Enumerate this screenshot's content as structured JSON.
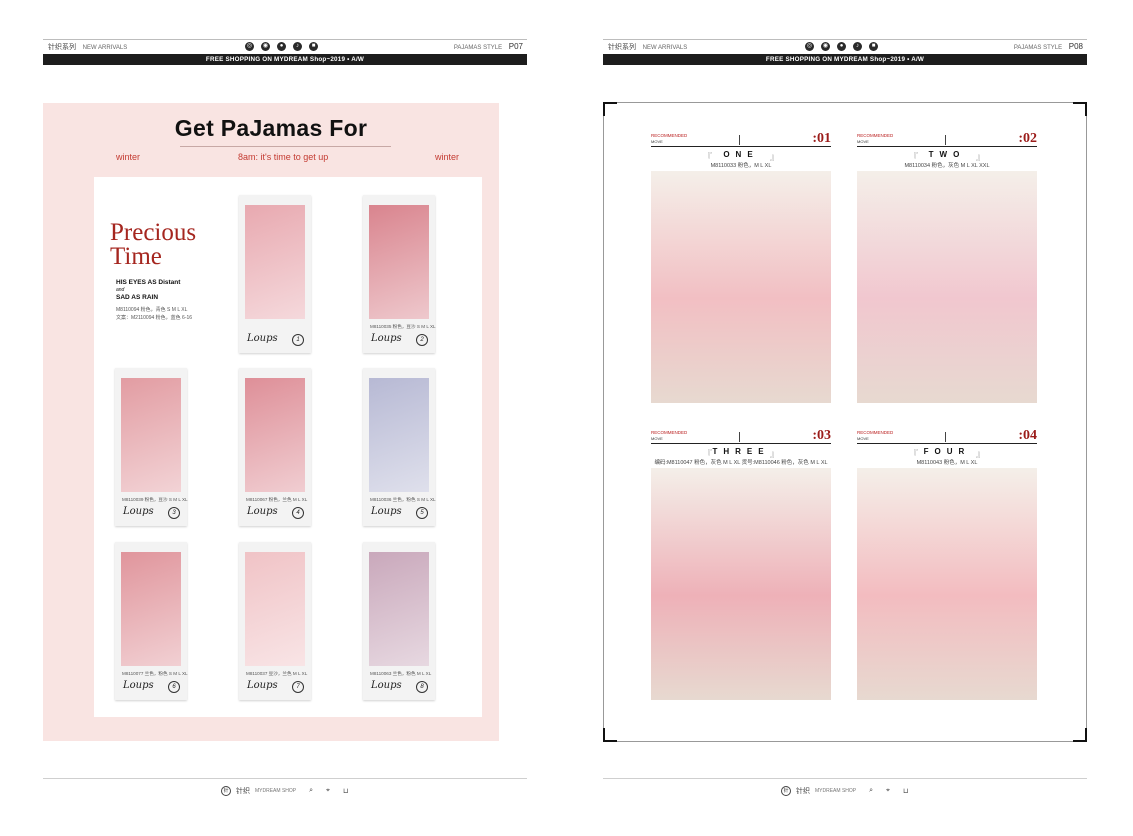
{
  "header": {
    "brand": "针织系列",
    "tagline": "NEW ARRIVALS",
    "right_label": "PAJAMAS STYLE",
    "left_page": "P07",
    "right_page": "P08",
    "banner": "FREE SHOPPING ON MYDREAM Shop~2019 • A/W"
  },
  "footer": {
    "brand": "针织",
    "site": "MYDREAM SHOP",
    "icons": [
      "search-icon",
      "location-icon",
      "cart-icon"
    ]
  },
  "left": {
    "title": "Get PaJamas For",
    "sub_left": "winter",
    "sub_center": "8am: it's time to get up",
    "sub_right": "winter",
    "precious_line1": "Precious",
    "precious_line2": "Time",
    "eyes_line1": "HIS EYES AS Distant",
    "eyes_and": "and",
    "eyes_line2": "SAD AS RAIN",
    "code_line1": "M8110094 粉色，青色 S M L XL",
    "code_line2": "文案：M2110094 粉色，蓝色 6-16",
    "signature": "Loups",
    "cards": [
      {
        "caption": "",
        "num": "1",
        "tone": "#e8a9b0"
      },
      {
        "caption": "M8110035 粉色，豆沙 S M L XL",
        "num": "2",
        "tone": "#d9848e"
      },
      {
        "caption": "M8110039 粉色，豆沙 S M L XL",
        "num": "3",
        "tone": "#e29ca2"
      },
      {
        "caption": "M8110067 粉色，兰色 M L XL",
        "num": "4",
        "tone": "#de8f98"
      },
      {
        "caption": "M8110036 兰色，粉色 S M L XL",
        "num": "5",
        "tone": "#b7b9d4"
      },
      {
        "caption": "M8110077 兰色，粉色 S M L XL",
        "num": "6",
        "tone": "#e0959c"
      },
      {
        "caption": "M8110037 豆沙，兰色 M L XL",
        "num": "7",
        "tone": "#f0c3c6"
      },
      {
        "caption": "M8110063 兰色，粉色 M L XL",
        "num": "8",
        "tone": "#c9a8bb"
      }
    ]
  },
  "right": {
    "rec_label": "RECOMMENDED",
    "rec_sub": "MOVE",
    "products": [
      {
        "tag": ":01",
        "name": "ONE",
        "code": "M8110033 粉色，M L XL",
        "tone": "#f2bfc3"
      },
      {
        "tag": ":02",
        "name": "TWO",
        "code": "M8110034 粉色，灰色 M L XL XXL",
        "tone": "#f1c7cf"
      },
      {
        "tag": ":03",
        "name": "THREE",
        "code": "编码:M8110047 粉色，灰色 M L XL  货号:M8110046 粉色，灰色 M L XL",
        "tone": "#eeb1b8"
      },
      {
        "tag": ":04",
        "name": "FOUR",
        "code": "M8110043 粉色，M L XL",
        "tone": "#f3bcc0"
      }
    ]
  }
}
